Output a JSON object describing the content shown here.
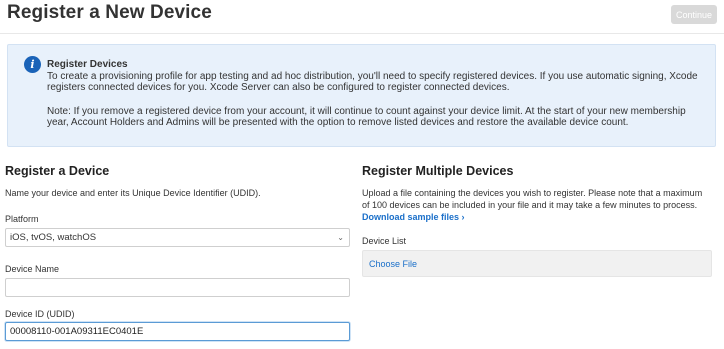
{
  "header": {
    "title": "Register a New Device",
    "continue_label": "Continue"
  },
  "info": {
    "heading": "Register Devices",
    "line1": "To create a provisioning profile for app testing and ad hoc distribution, you'll need to specify registered devices. If you use automatic signing, Xcode registers connected devices for you. Xcode Server can also be configured to register connected devices.",
    "line2": "Note: If you remove a registered device from your account, it will continue to count against your device limit. At the start of your new membership year, Account Holders and Admins will be presented with the option to remove listed devices and restore the available device count."
  },
  "register_one": {
    "title": "Register a Device",
    "description": "Name your device and enter its Unique Device Identifier (UDID).",
    "platform_label": "Platform",
    "platform_value": "iOS, tvOS, watchOS",
    "device_name_label": "Device Name",
    "device_name_value": "",
    "device_id_label": "Device ID (UDID)",
    "device_id_value": "00008110-001A09311EC0401E"
  },
  "register_multiple": {
    "title": "Register Multiple Devices",
    "description": "Upload a file containing the devices you wish to register. Please note that a maximum of 100 devices can be included in your file and it may take a few minutes to process.",
    "download_link": "Download sample files ›",
    "device_list_label": "Device List",
    "choose_file_label": "Choose File"
  },
  "colors": {
    "accent": "#1a6fc9",
    "info_bg": "#e8f1fb",
    "info_icon": "#1a63b8",
    "disabled_button": "#d9d9d9"
  },
  "icons": {
    "info": "info-icon",
    "select_chevron": "chevron-down-icon"
  }
}
